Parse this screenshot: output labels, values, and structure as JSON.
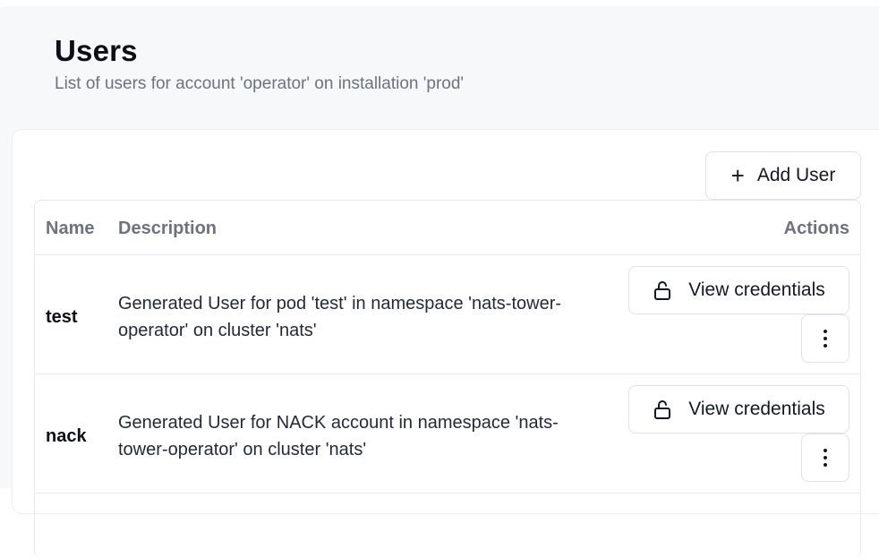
{
  "header": {
    "title": "Users",
    "subtitle": "List of users for account 'operator' on installation 'prod'"
  },
  "toolbar": {
    "add_user_label": "Add User",
    "add_icon": "plus-icon"
  },
  "table": {
    "columns": {
      "name": "Name",
      "description": "Description",
      "actions": "Actions"
    },
    "rows": [
      {
        "name": "test",
        "description": "Generated User for pod 'test' in namespace 'nats-tower-operator' on cluster 'nats'",
        "view_label": "View credentials"
      },
      {
        "name": "nack",
        "description": "Generated User for NACK account in namespace 'nats-tower-operator' on cluster 'nats'",
        "view_label": "View credentials"
      }
    ]
  },
  "icons": {
    "view": "lock-open-icon",
    "menu": "more-vertical-icon"
  }
}
